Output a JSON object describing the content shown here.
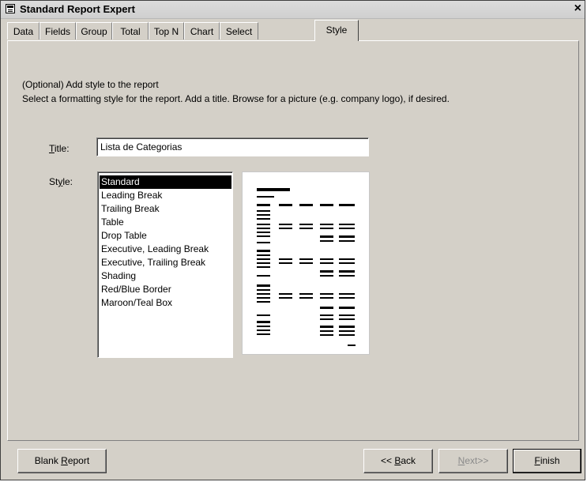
{
  "window": {
    "title": "Standard Report Expert",
    "close_glyph": "×"
  },
  "tabs": [
    "Data",
    "Fields",
    "Group",
    "Total",
    "Top N",
    "Chart",
    "Select",
    "Style"
  ],
  "active_tab": "Style",
  "description": {
    "line1": "(Optional) Add style to the report",
    "line2": "Select a formatting style for the report.  Add a title.  Browse for a picture (e.g. company logo), if desired."
  },
  "form": {
    "title_label_mnemonic": "T",
    "title_label_rest": "itle:",
    "title_value": "Lista de Categorias",
    "style_label_pre": "St",
    "style_label_mnemonic": "y",
    "style_label_rest": "le:",
    "styles": [
      "Standard",
      "Leading Break",
      "Trailing Break",
      "Table",
      "Drop Table",
      "Executive, Leading Break",
      "Executive, Trailing Break",
      "Shading",
      "Red/Blue Border",
      "Maroon/Teal Box"
    ],
    "selected_style": "Standard"
  },
  "buttons": {
    "blank_report_pre": "Blank ",
    "blank_report_mnemonic": "R",
    "blank_report_rest": "eport",
    "back_pre": "<< ",
    "back_mnemonic": "B",
    "back_rest": "ack",
    "next_mnemonic": "N",
    "next_rest": "ext>>",
    "finish_mnemonic": "F",
    "finish_rest": "inish"
  },
  "icons": {
    "app": "report-expert-icon",
    "preview": "style-preview-thumbnail"
  }
}
